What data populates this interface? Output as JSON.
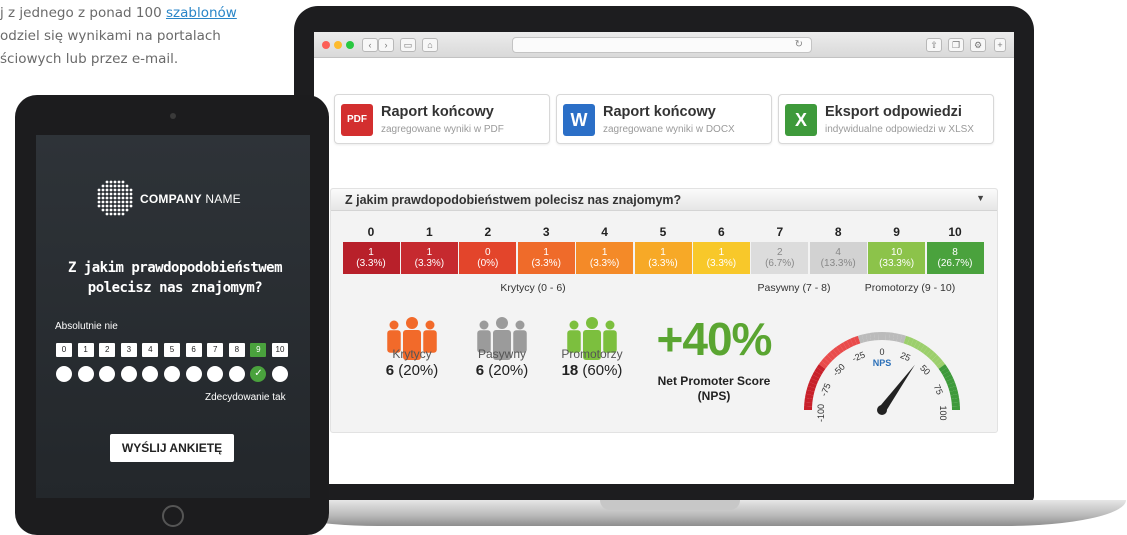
{
  "intro": {
    "line1_pre": "j z jednego z ponad 100 ",
    "line1_link": "szablonów",
    "line2": "odziel się wynikami na portalach",
    "line3": "ściowych lub przez e-mail."
  },
  "colors": {
    "accent_green": "#5aa531",
    "link": "#2a86c8",
    "pdf": "#d32f2f",
    "docx": "#2b6fc7",
    "xlsx": "#3e9a3b"
  },
  "reports": [
    {
      "icon": "pdf-icon",
      "icon_text": "PDF",
      "title": "Raport końcowy",
      "subtitle": "zagregowane wyniki w PDF"
    },
    {
      "icon": "word-icon",
      "icon_text": "W",
      "title": "Raport końcowy",
      "subtitle": "zagregowane wyniki w DOCX"
    },
    {
      "icon": "excel-icon",
      "icon_text": "X",
      "title": "Eksport odpowiedzi",
      "subtitle": "indywidualne odpowiedzi w XLSX"
    }
  ],
  "question": "Z jakim prawdopodobieństwem polecisz nas znajomym?",
  "scale": [
    {
      "n": "0",
      "count": "1",
      "pct": "(3.3%)",
      "color": "#b8202a"
    },
    {
      "n": "1",
      "count": "1",
      "pct": "(3.3%)",
      "color": "#c62a2f"
    },
    {
      "n": "2",
      "count": "0",
      "pct": "(0%)",
      "color": "#e3452b"
    },
    {
      "n": "3",
      "count": "1",
      "pct": "(3.3%)",
      "color": "#ef6b2a"
    },
    {
      "n": "4",
      "count": "1",
      "pct": "(3.3%)",
      "color": "#f48a28"
    },
    {
      "n": "5",
      "count": "1",
      "pct": "(3.3%)",
      "color": "#f7a927"
    },
    {
      "n": "6",
      "count": "1",
      "pct": "(3.3%)",
      "color": "#f8c82a"
    },
    {
      "n": "7",
      "count": "2",
      "pct": "(6.7%)",
      "color": "#dcdcdc"
    },
    {
      "n": "8",
      "count": "4",
      "pct": "(13.3%)",
      "color": "#d2d2d2"
    },
    {
      "n": "9",
      "count": "10",
      "pct": "(33.3%)",
      "color": "#8cc34a"
    },
    {
      "n": "10",
      "count": "8",
      "pct": "(26.7%)",
      "color": "#4aa23d"
    }
  ],
  "groups": {
    "detractors": "Krytycy (0 - 6)",
    "passives": "Pasywny (7 - 8)",
    "promoters": "Promotorzy (9 - 10)"
  },
  "summary": [
    {
      "label": "Krytycy",
      "count": "6",
      "pct": "(20%)",
      "color": "#f26a2a"
    },
    {
      "label": "Pasywny",
      "count": "6",
      "pct": "(20%)",
      "color": "#9b9b9b"
    },
    {
      "label": "Promotorzy",
      "count": "18",
      "pct": "(60%)",
      "color": "#7cbf3e"
    }
  ],
  "nps": {
    "value": "+40%",
    "label_line1": "Net Promoter Score",
    "label_line2": "(NPS)",
    "gauge_title": "NPS",
    "gauge_value": 40,
    "ticks": [
      "-100",
      "-75",
      "-50",
      "-25",
      "0",
      "25",
      "50",
      "75",
      "100"
    ]
  },
  "tablet": {
    "company_bold": "COMPANY",
    "company_rest": " NAME",
    "question_line1": "Z jakim prawdopodobieństwem",
    "question_line2": "polecisz nas znajomym?",
    "low_label": "Absolutnie nie",
    "high_label": "Zdecydowanie tak",
    "numbers": [
      "0",
      "1",
      "2",
      "3",
      "4",
      "5",
      "6",
      "7",
      "8",
      "9",
      "10"
    ],
    "selected": "9",
    "send": "WYŚLIJ ANKIETĘ"
  }
}
